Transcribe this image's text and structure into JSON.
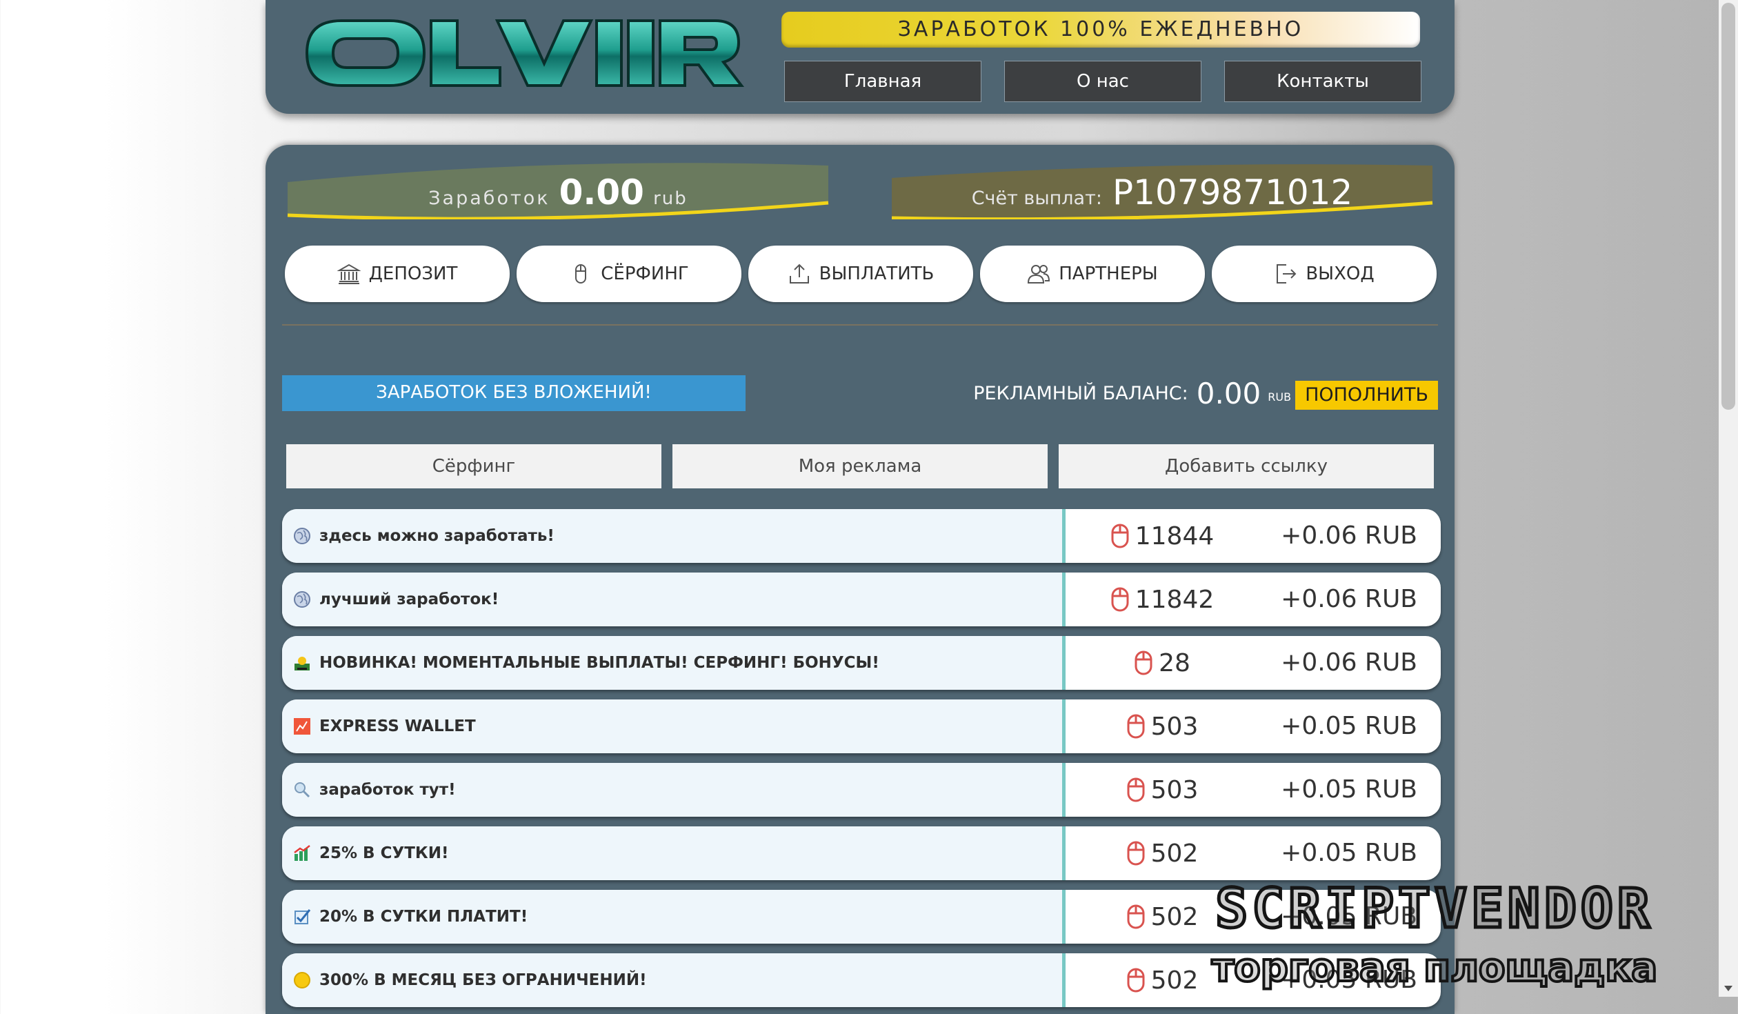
{
  "header": {
    "logo_text": "OLVIIR",
    "slogan": "ЗАРАБОТОК 100% ЕЖЕДНЕВНО",
    "nav": [
      "Главная",
      "О нас",
      "Контакты"
    ]
  },
  "stats": {
    "earnings_label": "Заработок",
    "earnings_value": "0.00",
    "earnings_unit": "rub",
    "account_label": "Счёт выплат:",
    "account_value": "P1079871012"
  },
  "menu": [
    {
      "label": "ДЕПОЗИТ",
      "icon": "bank-icon"
    },
    {
      "label": "СЁРФИНГ",
      "icon": "mouse-icon"
    },
    {
      "label": "ВЫПЛАТИТЬ",
      "icon": "upload-icon"
    },
    {
      "label": "ПАРТНЕРЫ",
      "icon": "users-icon"
    },
    {
      "label": "ВЫХОД",
      "icon": "logout-icon"
    }
  ],
  "promo": {
    "noinvest_label": "ЗАРАБОТОК БЕЗ ВЛОЖЕНИЙ!",
    "ad_balance_label": "РЕКЛАМНЫЙ БАЛАНС:",
    "ad_balance_value": "0.00",
    "ad_balance_unit": "RUB",
    "topup_label": "ПОПОЛНИТЬ"
  },
  "tabs": [
    "Сёрфинг",
    "Моя реклама",
    "Добавить ссылку"
  ],
  "links": [
    {
      "title": "здесь можно заработать!",
      "icon": "globe-icon",
      "views": "11844",
      "reward": "+0.06 RUB"
    },
    {
      "title": "лучший заработок!",
      "icon": "globe-icon",
      "views": "11842",
      "reward": "+0.06 RUB"
    },
    {
      "title": "НОВИНКА! МОМЕНТАЛЬНЫЕ ВЫПЛАТЫ! СЕРФИНГ! БОНУСЫ!",
      "icon": "money-icon",
      "views": "28",
      "reward": "+0.06 RUB"
    },
    {
      "title": "EXPRESS WALLET",
      "icon": "chart-icon",
      "views": "503",
      "reward": "+0.05 RUB"
    },
    {
      "title": "заработок тут!",
      "icon": "search-icon",
      "views": "503",
      "reward": "+0.05 RUB"
    },
    {
      "title": "25% В СУТКИ!",
      "icon": "growth-chart-icon",
      "views": "502",
      "reward": "+0.05 RUB"
    },
    {
      "title": "20% В СУТКИ ПЛАТИТ!",
      "icon": "checkmark-icon",
      "views": "502",
      "reward": "+0.05 RUB"
    },
    {
      "title": "300% В МЕСЯЦ БЕЗ ОГРАНИЧЕНИЙ!",
      "icon": "coin-icon",
      "views": "502",
      "reward": "+0.05 RUB"
    }
  ],
  "watermark": {
    "brand": "SCRIPTVENDOR",
    "tagline": "торговая площадка"
  },
  "colors": {
    "panel": "#4f6572",
    "slogan_yellow": "#e6cc1e",
    "noinvest_blue": "#3a96d0",
    "topup_yellow": "#f7c800",
    "row_separator": "#78c8c4",
    "mouse_icon_red": "#d9534f"
  }
}
